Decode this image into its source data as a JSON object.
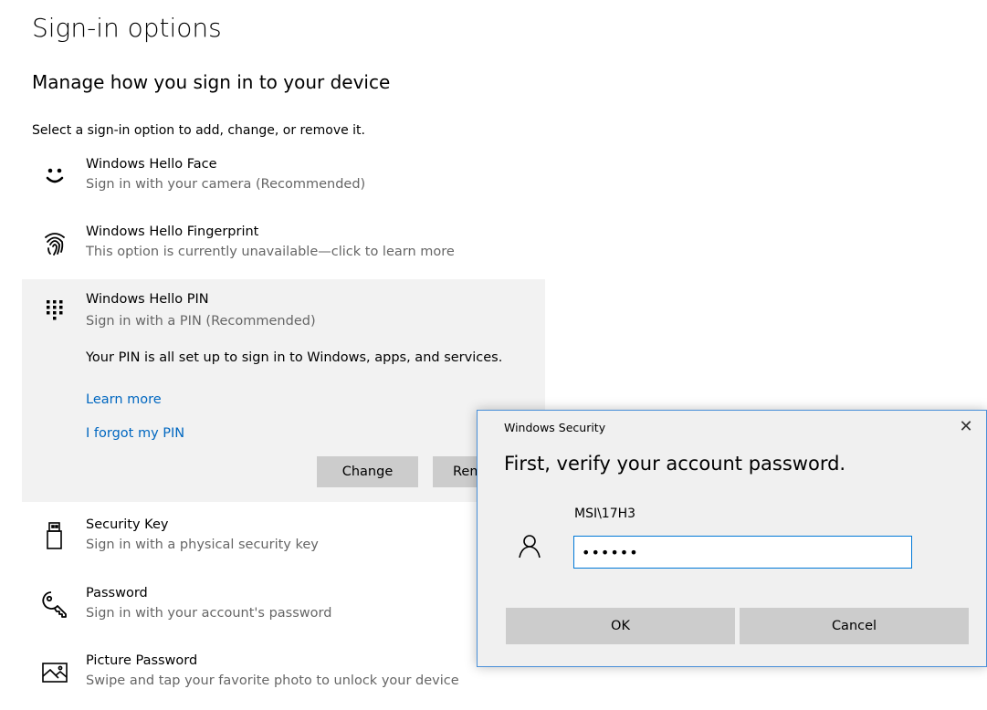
{
  "page": {
    "title": "Sign-in options",
    "section_title": "Manage how you sign in to your device",
    "intro": "Select a sign-in option to add, change, or remove it."
  },
  "options": {
    "face": {
      "name": "Windows Hello Face",
      "desc": "Sign in with your camera (Recommended)",
      "icon": "smiley-face-icon"
    },
    "fingerprint": {
      "name": "Windows Hello Fingerprint",
      "desc": "This option is currently unavailable—click to learn more",
      "icon": "fingerprint-icon"
    },
    "pin": {
      "name": "Windows Hello PIN",
      "desc": "Sign in with a PIN (Recommended)",
      "icon": "keypad-icon",
      "status": "Your PIN is all set up to sign in to Windows, apps, and services.",
      "learn_more": "Learn more",
      "forgot": "I forgot my PIN",
      "change_label": "Change",
      "remove_label": "Remove"
    },
    "security_key": {
      "name": "Security Key",
      "desc": "Sign in with a physical security key",
      "icon": "usb-key-icon"
    },
    "password": {
      "name": "Password",
      "desc": "Sign in with your account's password",
      "icon": "key-icon"
    },
    "picture": {
      "name": "Picture Password",
      "desc": "Swipe and tap your favorite photo to unlock your device",
      "icon": "picture-icon"
    }
  },
  "dialog": {
    "title": "Windows Security",
    "close": "✕",
    "heading": "First, verify your account password.",
    "username": "MSI\\17H3",
    "password_value": "••••••",
    "ok_label": "OK",
    "cancel_label": "Cancel"
  },
  "colors": {
    "accent": "#0067c0",
    "dialog_border": "#4a90d9",
    "button_grey": "#cccccc"
  }
}
